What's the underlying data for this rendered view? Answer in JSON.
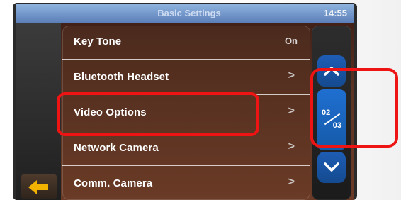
{
  "app": {
    "title": "Basic Settings",
    "time": "14:55"
  },
  "menu": {
    "items": [
      {
        "label": "Key Tone",
        "value": "On",
        "chevron": ""
      },
      {
        "label": "Bluetooth Headset",
        "value": "",
        "chevron": ">"
      },
      {
        "label": "Video Options",
        "value": "",
        "chevron": ">"
      },
      {
        "label": "Network Camera",
        "value": "",
        "chevron": ">"
      },
      {
        "label": "Comm. Camera",
        "value": "",
        "chevron": ">"
      }
    ]
  },
  "pager": {
    "current": "02",
    "total": "03"
  },
  "icons": {
    "back": "back-arrow-icon",
    "scroll_up": "chevron-up-icon",
    "scroll_down": "chevron-down-icon"
  },
  "colors": {
    "annotation": "#ef1414",
    "accent_blue": "#1f6fd1",
    "back_arrow": "#f2b200"
  }
}
